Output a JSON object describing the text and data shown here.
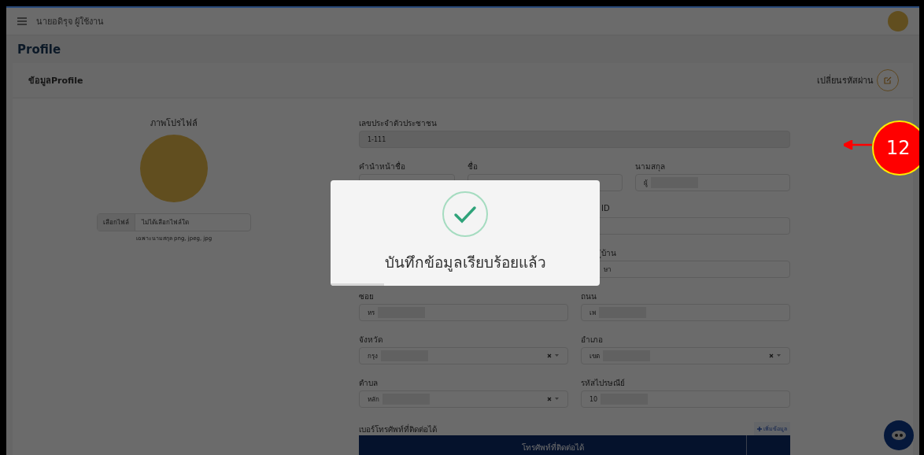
{
  "topbar": {
    "user": "นายอดิรุจ ผู้ใช้งาน"
  },
  "page_title": "Profile",
  "card": {
    "title": "ข้อมูลProfile",
    "change_password": "เปลี่ยนรหัสผ่าน"
  },
  "profile_picture": {
    "label": "ภาพโปรไฟล์",
    "file_button": "เลือกไฟล์",
    "file_status": "ไม่ได้เลือกไฟล์ใด",
    "hint": "เฉพาะนามสกุล png, jpeg, jpg"
  },
  "form_rows": [
    [
      {
        "kind": "disabled",
        "label": "เลขประจำตัวประชาชน",
        "value": "1-111"
      }
    ],
    [
      {
        "kind": "text",
        "label": "คำนำหน้าชื่อ"
      },
      {
        "kind": "text",
        "label": "ชื่อ"
      },
      {
        "kind": "text",
        "label": "นามสกุล",
        "value": "ผู้",
        "redacted": true
      }
    ],
    [
      {
        "kind": "hidden"
      },
      {
        "kind": "text",
        "label": "ID",
        "partly_covered": true
      }
    ],
    [
      {
        "kind": "hidden"
      },
      {
        "kind": "text",
        "label": "ู่บ้าน",
        "value": "ษา",
        "partly_covered": true
      }
    ],
    [
      {
        "kind": "text",
        "label": "ซอย",
        "value": "หร",
        "redacted": true
      },
      {
        "kind": "text",
        "label": "ถนน",
        "value": "เพ",
        "redacted": true
      }
    ],
    [
      {
        "kind": "select",
        "label": "จังหวัด",
        "value": "กรุง",
        "redacted": true
      },
      {
        "kind": "select",
        "label": "อำเภอ",
        "value": "เขต",
        "redacted": true
      }
    ],
    [
      {
        "kind": "select",
        "label": "ตำบล",
        "value": "หลัก",
        "redacted": true
      },
      {
        "kind": "text",
        "label": "รหัสไปรษณีย์",
        "value": "10",
        "redacted": true
      }
    ]
  ],
  "phone": {
    "label": "เบอร์โทรศัพท์ที่ติดต่อได้",
    "add_button": "เพิ่มข้อมูล",
    "table_columns": [
      "โทรศัพท์ที่ติดต่อได้",
      ""
    ]
  },
  "alert": {
    "message": "บันทึกข้อมูลเรียบร้อยแล้ว",
    "timer": {
      "level": 0.2
    }
  },
  "annotation": {
    "number": "12"
  }
}
